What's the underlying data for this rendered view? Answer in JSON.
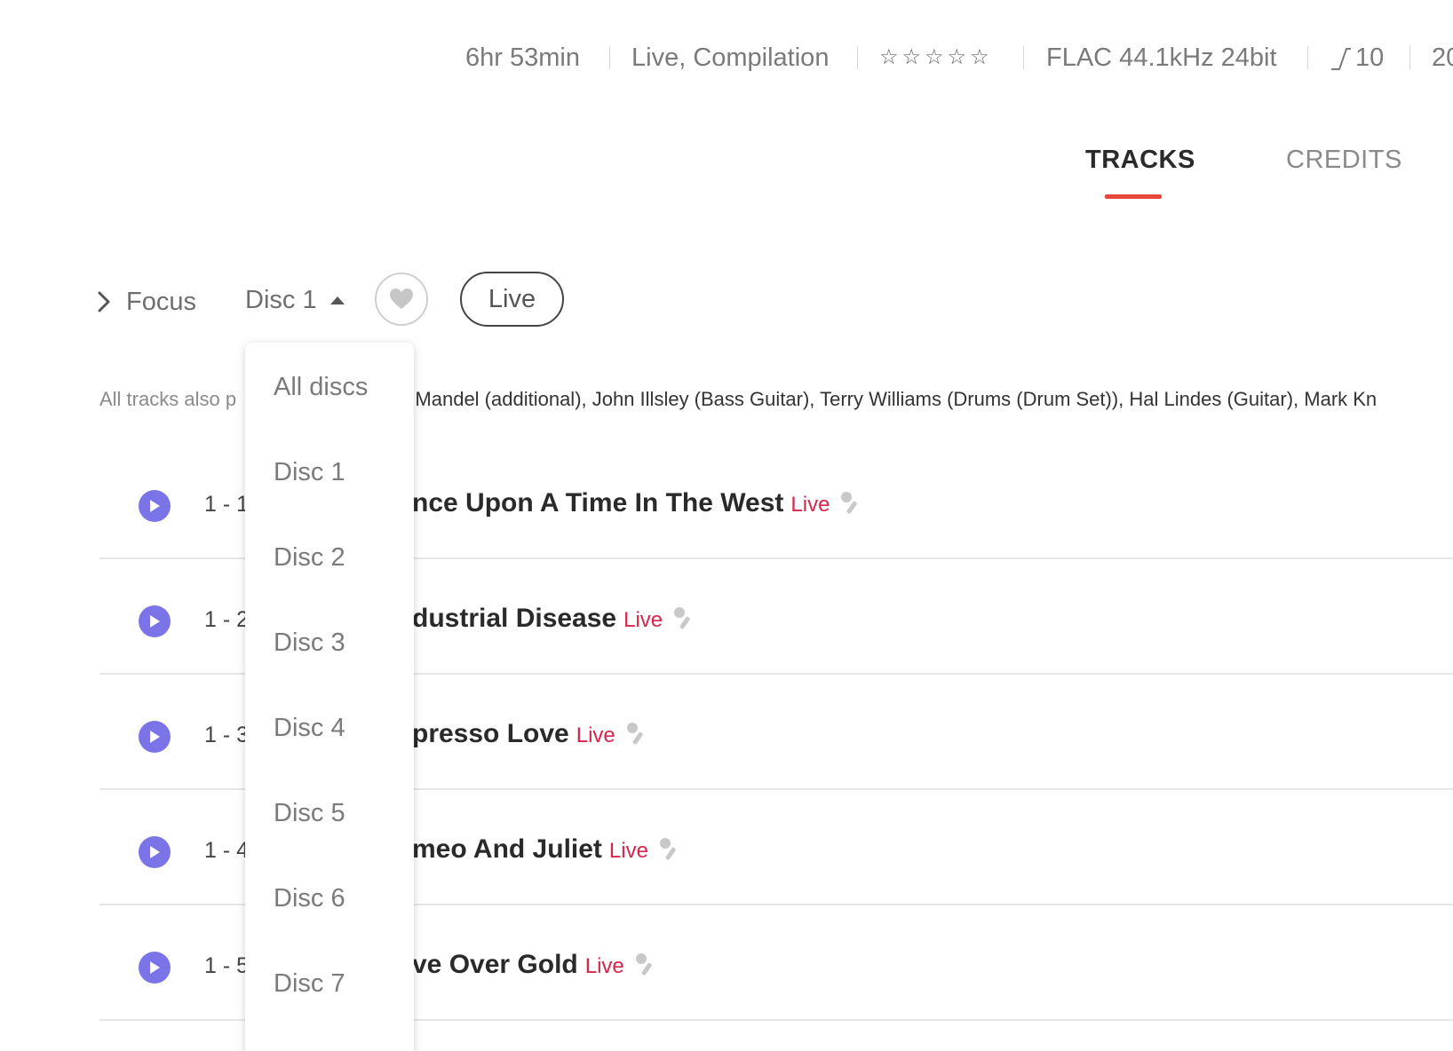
{
  "meta": {
    "duration": "6hr 53min",
    "genres": "Live, Compilation",
    "rating_stars": "☆☆☆☆☆",
    "format": "FLAC 44.1kHz 24bit",
    "dynamic_range": "10",
    "year_partial": "20"
  },
  "tabs": {
    "tracks": "TRACKS",
    "credits": "CREDITS"
  },
  "toolbar": {
    "focus_label": "Focus",
    "disc_selected": "Disc 1",
    "live_chip": "Live"
  },
  "credits_line": {
    "lead": "All tracks also p",
    "text": "ny Mandel (additional), John Illsley (Bass Guitar), Terry Williams (Drums (Drum Set)), Hal Lindes (Guitar), Mark Kn"
  },
  "tracks": [
    {
      "num": "1 - 1",
      "title": "nce Upon A Time In The West",
      "tag": "Live"
    },
    {
      "num": "1 - 2",
      "title": "dustrial Disease",
      "tag": "Live"
    },
    {
      "num": "1 - 3",
      "title": "presso Love",
      "tag": "Live"
    },
    {
      "num": "1 - 4",
      "title": "meo And Juliet",
      "tag": "Live"
    },
    {
      "num": "1 - 5",
      "title": "ve Over Gold",
      "tag": "Live"
    }
  ],
  "disc_dropdown": {
    "options": [
      "All discs",
      "Disc 1",
      "Disc 2",
      "Disc 3",
      "Disc 4",
      "Disc 5",
      "Disc 6",
      "Disc 7"
    ]
  },
  "colors": {
    "accent_underline": "#e8473b",
    "play_button": "#7b74e8",
    "live_tag": "#d8264a"
  }
}
